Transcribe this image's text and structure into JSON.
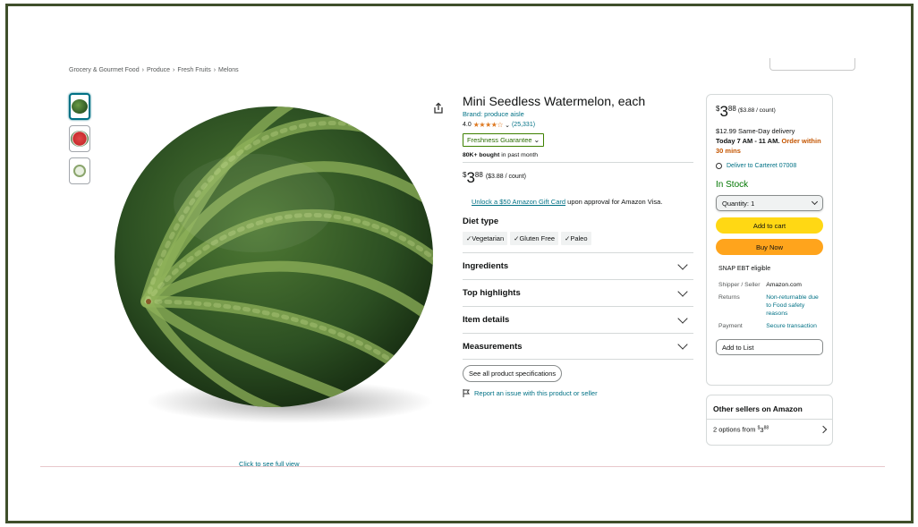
{
  "breadcrumb": [
    "Grocery & Gourmet Food",
    "Produce",
    "Fresh Fruits",
    "Melons"
  ],
  "gallery": {
    "thumbnails": [
      "watermelon-whole-icon",
      "watermelon-slice-icon",
      "freshness-badge-icon"
    ],
    "click_full_view": "Click to see full view"
  },
  "product": {
    "title": "Mini Seedless Watermelon, each",
    "brand": "Brand: produce aisle",
    "rating": "4.0",
    "stars": "★★★★☆",
    "rating_count": "(25,331)",
    "freshness": "Freshness Guarantee",
    "bought_bold": "80K+ bought",
    "bought_rest": " in past month",
    "price_symbol": "$",
    "price_whole": "3",
    "price_fraction": "88",
    "price_unit": "($3.88 / count)",
    "gift_link": "Unlock a $50 Amazon Gift Card",
    "gift_rest": " upon approval for Amazon Visa.",
    "diet_heading": "Diet type",
    "diet_chips": [
      "✓Vegetarian",
      "✓Gluten Free",
      "✓Paleo"
    ],
    "accordions": [
      "Ingredients",
      "Top highlights",
      "Item details",
      "Measurements"
    ],
    "spec_button": "See all product specifications",
    "report": "Report an issue with this product or seller"
  },
  "buybox": {
    "price_symbol": "$",
    "price_whole": "3",
    "price_fraction": "88",
    "price_unit": "($3.88 / count)",
    "delivery_line1": "$12.99 Same-Day delivery",
    "delivery_bold": "Today 7 AM - 11 AM.",
    "delivery_order": " Order within 30 mins",
    "deliver_to": "Deliver to Carteret 07008",
    "stock": "In Stock",
    "quantity": "Quantity: 1",
    "add_to_cart": "Add to cart",
    "buy_now": "Buy Now",
    "snap": "SNAP EBT eligible",
    "shipper_label": "Shipper / Seller",
    "shipper_value": "Amazon.com",
    "returns_label": "Returns",
    "returns_value": "Non-returnable due to Food safety reasons",
    "payment_label": "Payment",
    "payment_value": "Secure transaction",
    "add_to_list": "Add to List"
  },
  "other_sellers": {
    "heading": "Other sellers on Amazon",
    "options": "2 options from ",
    "price_symbol": "$",
    "price_whole": "3",
    "price_fraction": "88"
  },
  "colors": {
    "frame": "#3f4f2b",
    "link": "#007185",
    "star": "#de7921",
    "in_stock": "#007600",
    "add_to_cart": "#ffd814",
    "buy_now": "#ffa41c",
    "order_urgent": "#c45500"
  }
}
